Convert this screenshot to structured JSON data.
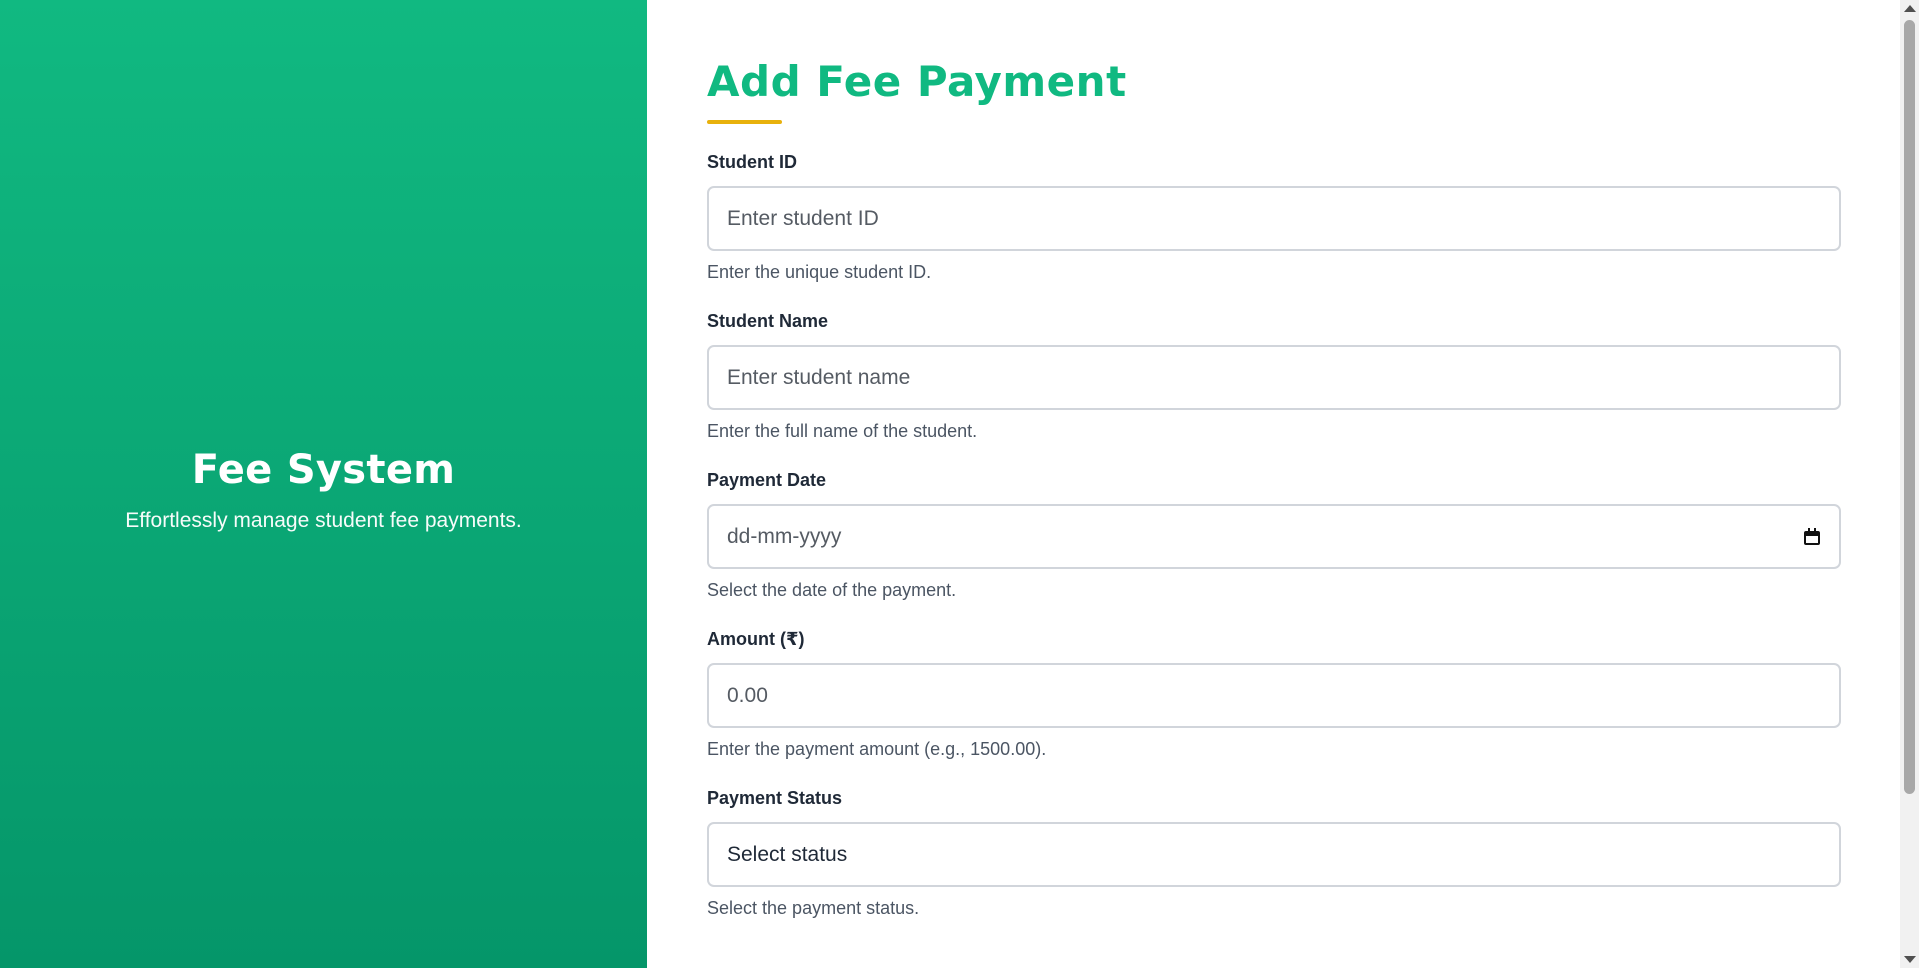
{
  "brand": {
    "title": "Fee System",
    "tagline": "Effortlessly manage student fee payments."
  },
  "form": {
    "title": "Add Fee Payment",
    "fields": [
      {
        "label": "Student ID",
        "placeholder": "Enter student ID",
        "helper": "Enter the unique student ID."
      },
      {
        "label": "Student Name",
        "placeholder": "Enter student name",
        "helper": "Enter the full name of the student."
      },
      {
        "label": "Payment Date",
        "placeholder": "dd-mm-yyyy",
        "helper": "Select the date of the payment.",
        "icon": "calendar-icon"
      },
      {
        "label": "Amount (₹)",
        "placeholder": "0.00",
        "helper": "Enter the payment amount (e.g., 1500.00)."
      },
      {
        "label": "Payment Status",
        "selected": "Select status",
        "helper": "Select the payment status."
      }
    ]
  },
  "colors": {
    "brand_gradient_top": "#11b981",
    "brand_gradient_bottom": "#059669",
    "title_green": "#10b981",
    "underline_accent": "#e8b10c"
  }
}
